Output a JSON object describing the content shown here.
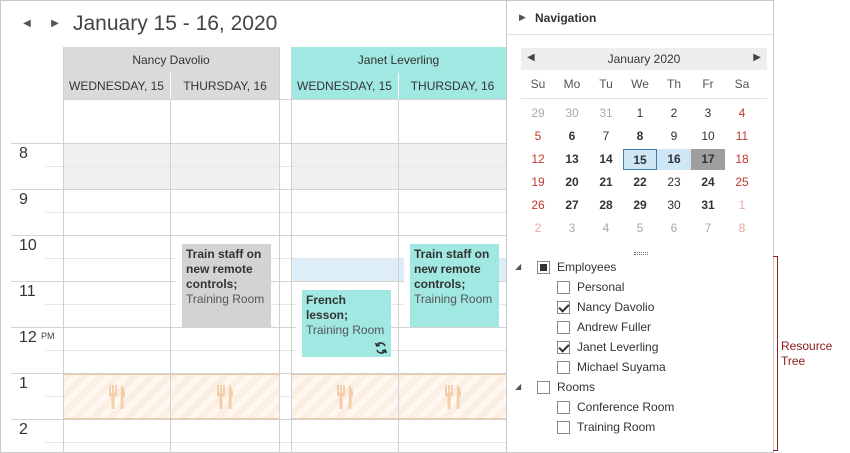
{
  "header": {
    "date_range": "January 15 - 16, 2020",
    "prev_icon": "triangle-left-icon",
    "next_icon": "triangle-right-icon"
  },
  "resources": [
    {
      "name": "Nancy Davolio",
      "days": [
        "WEDNESDAY, 15",
        "THURSDAY, 16"
      ],
      "color": "#dadada"
    },
    {
      "name": "Janet Leverling",
      "days": [
        "WEDNESDAY, 15",
        "THURSDAY, 16"
      ],
      "color": "#a0e8e1"
    }
  ],
  "time_ruler": {
    "hours": [
      "8",
      "9",
      "10",
      "11",
      "12",
      "1",
      "2"
    ],
    "pm_marker": "PM"
  },
  "appointments": [
    {
      "title": "Train staff on new remote controls;",
      "location": "Training Room",
      "resource": "Nancy Davolio",
      "day": "THURSDAY, 16"
    },
    {
      "title": "Train staff on new remote controls;",
      "location": "Training Room",
      "resource": "Janet Leverling",
      "day": "THURSDAY, 16"
    },
    {
      "title": "French lesson;",
      "location": "Training Room",
      "resource": "Janet Leverling",
      "day": "WEDNESDAY, 15",
      "recurring_icon": "recurrence-icon"
    }
  ],
  "lunch_icon": "fork-knife-icon",
  "navigation": {
    "title": "Navigation",
    "collapse_icon": "caret-right-icon",
    "calendar": {
      "month_label": "January 2020",
      "prev_icon": "triangle-left-icon",
      "next_icon": "triangle-right-icon",
      "weekdays": [
        "Su",
        "Mo",
        "Tu",
        "We",
        "Th",
        "Fr",
        "Sa"
      ],
      "weeks": [
        [
          "29",
          "30",
          "31",
          "1",
          "2",
          "3",
          "4"
        ],
        [
          "5",
          "6",
          "7",
          "8",
          "9",
          "10",
          "11"
        ],
        [
          "12",
          "13",
          "14",
          "15",
          "16",
          "17",
          "18"
        ],
        [
          "19",
          "20",
          "21",
          "22",
          "23",
          "24",
          "25"
        ],
        [
          "26",
          "27",
          "28",
          "29",
          "30",
          "31",
          "1"
        ],
        [
          "2",
          "3",
          "4",
          "5",
          "6",
          "7",
          "8"
        ]
      ],
      "today": "15",
      "selected": [
        "15",
        "16"
      ],
      "highlighted": "17"
    },
    "resource_tree": [
      {
        "label": "Employees",
        "level": 0,
        "state": "indeterminate",
        "expanded": true
      },
      {
        "label": "Personal",
        "level": 1,
        "state": "unchecked"
      },
      {
        "label": "Nancy Davolio",
        "level": 1,
        "state": "checked"
      },
      {
        "label": "Andrew Fuller",
        "level": 1,
        "state": "unchecked"
      },
      {
        "label": "Janet Leverling",
        "level": 1,
        "state": "checked"
      },
      {
        "label": "Michael Suyama",
        "level": 1,
        "state": "unchecked"
      },
      {
        "label": "Rooms",
        "level": 0,
        "state": "unchecked",
        "expanded": true
      },
      {
        "label": "Conference Room",
        "level": 1,
        "state": "unchecked"
      },
      {
        "label": "Training Room",
        "level": 1,
        "state": "unchecked"
      }
    ]
  },
  "annotation": {
    "line1": "Resource",
    "line2": "Tree",
    "color": "#8b1a1a"
  }
}
